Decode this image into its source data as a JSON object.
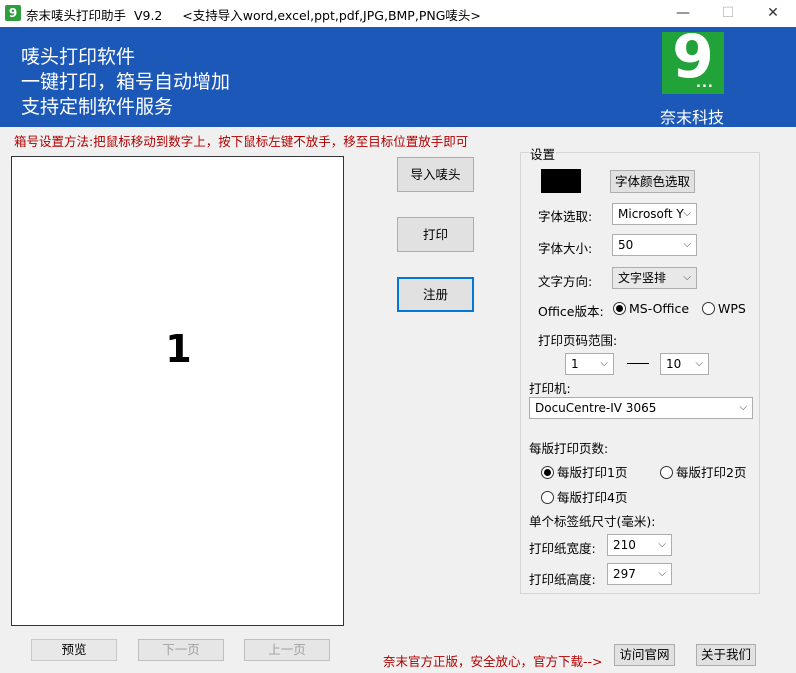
{
  "window": {
    "title": "奈末唛头打印助手  V9.2     <支持导入word,excel,ppt,pdf,JPG,BMP,PNG唛头>",
    "icon_text": "9",
    "controls": {
      "minimize": "—",
      "maximize": "☐",
      "close": "✕"
    }
  },
  "banner": {
    "lines": [
      "唛头打印软件",
      "一键打印，箱号自动增加",
      "支持定制软件服务"
    ],
    "logo_glyph": "9",
    "logo_dots": "...",
    "company": "奈末科技",
    "background": "#1b58b8",
    "logo_color": "#21a33a"
  },
  "hint": "箱号设置方法:把鼠标移动到数字上，按下鼠标左键不放手，移至目标位置放手即可",
  "preview": {
    "number": "1"
  },
  "actions": {
    "import": "导入唛头",
    "print": "打印",
    "register": "注册"
  },
  "settings": {
    "title": "设置",
    "color_button": "字体颜色选取",
    "font_label": "字体选取:",
    "font_value": "Microsoft Y",
    "size_label": "字体大小:",
    "size_value": "50",
    "direction_label": "文字方向:",
    "direction_value": "文字竖排",
    "office_label": "Office版本:",
    "office_options": [
      "MS-Office",
      "WPS"
    ],
    "office_selected": "MS-Office",
    "range_label": "打印页码范围:",
    "range_from": "1",
    "range_to": "10",
    "printer_label": "打印机:",
    "printer_value": "DocuCentre-IV 3065",
    "per_sheet_label": "每版打印页数:",
    "per_sheet_options": [
      "每版打印1页",
      "每版打印2页",
      "每版打印4页"
    ],
    "per_sheet_selected": "每版打印1页",
    "size_section_label": "单个标签纸尺寸(毫米):",
    "width_label": "打印纸宽度:",
    "width_value": "210",
    "height_label": "打印纸高度:",
    "height_value": "297"
  },
  "nav": {
    "preview": "预览",
    "next": "下一页",
    "prev": "上一页"
  },
  "footer": {
    "note": "奈末官方正版，安全放心，官方下载-->",
    "website": "访问官网",
    "about": "关于我们"
  },
  "colors": {
    "accent": "#0078d7",
    "warning_text": "#b00000"
  }
}
